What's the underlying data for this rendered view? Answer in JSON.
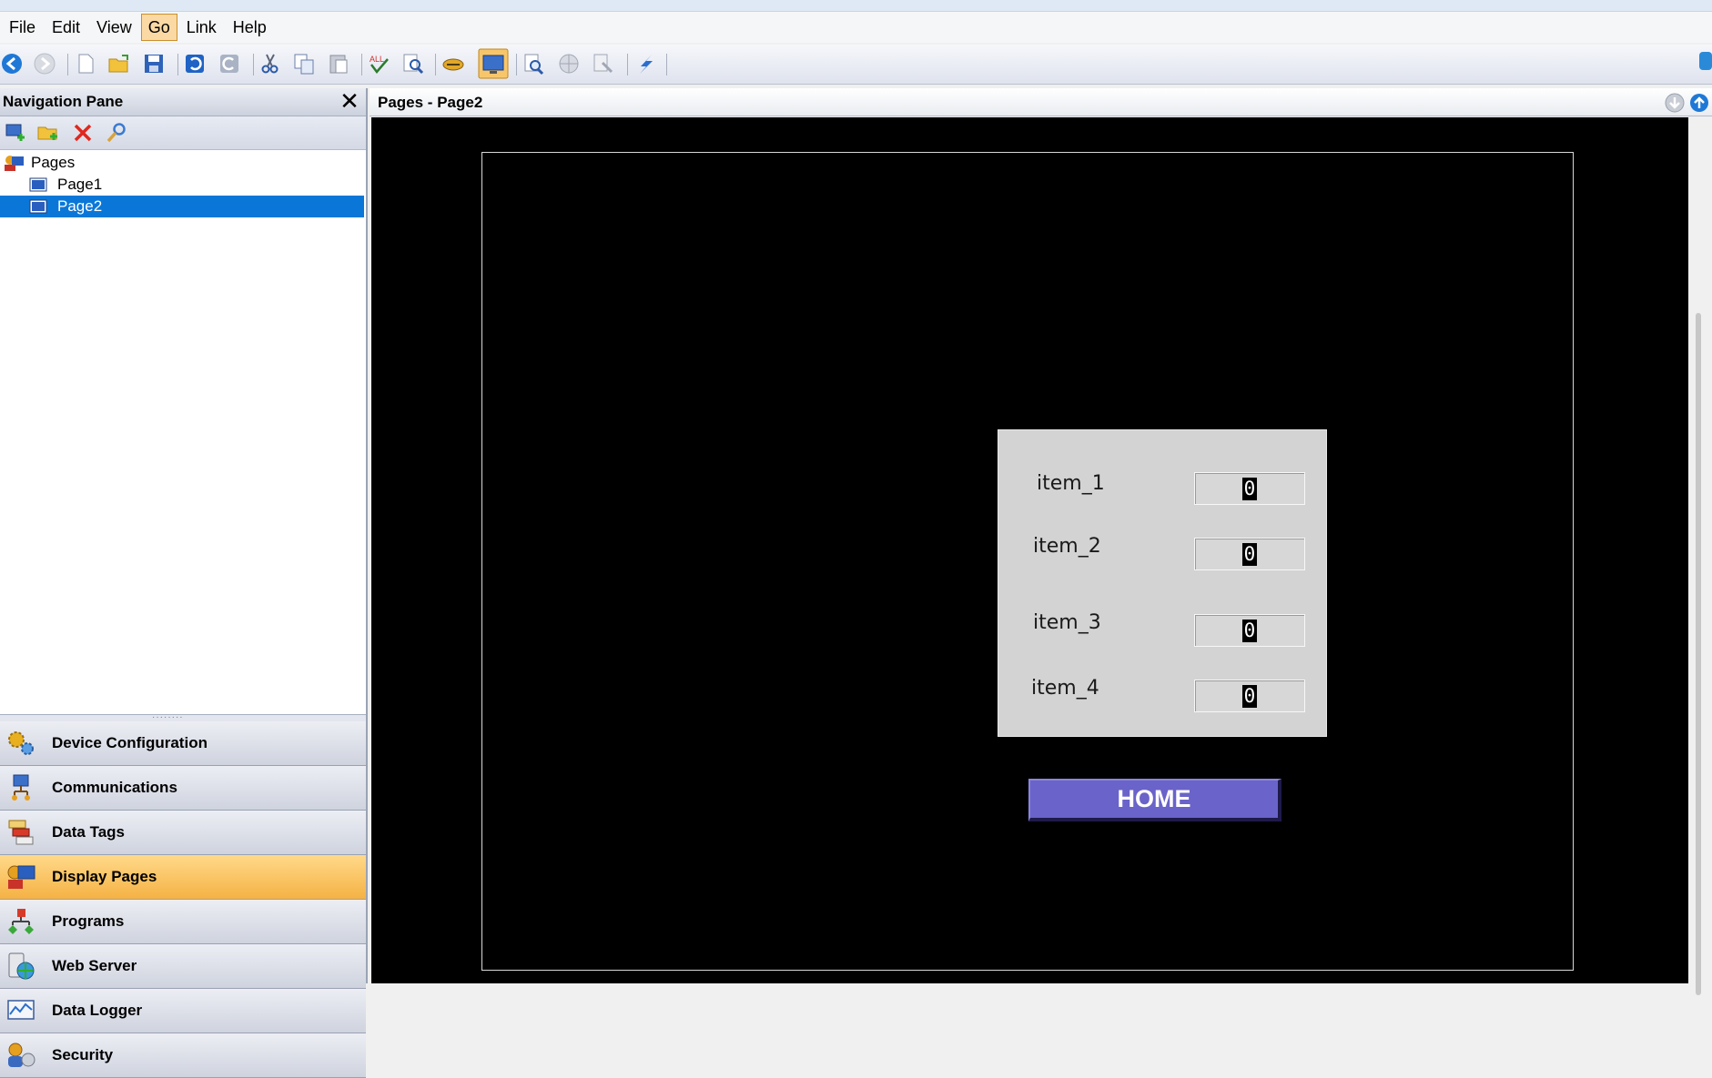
{
  "menu": {
    "items": [
      {
        "label": "File",
        "active": false
      },
      {
        "label": "Edit",
        "active": false
      },
      {
        "label": "View",
        "active": false
      },
      {
        "label": "Go",
        "active": true
      },
      {
        "label": "Link",
        "active": false
      },
      {
        "label": "Help",
        "active": false
      }
    ]
  },
  "toolbar": {
    "icons": [
      "back-icon",
      "forward-icon",
      "new-icon",
      "open-icon",
      "save-icon",
      "undo-icon",
      "redo-icon",
      "cut-icon",
      "copy-icon",
      "paste-icon",
      "spell-check-icon",
      "find-replace-icon",
      "handshake-icon",
      "display-icon",
      "zoom-icon",
      "globe-icon",
      "print-icon",
      "lightning-icon"
    ],
    "active_icon": "display-icon"
  },
  "nav": {
    "title": "Navigation Pane",
    "tree": {
      "root": "Pages",
      "children": [
        {
          "label": "Page1",
          "selected": false
        },
        {
          "label": "Page2",
          "selected": true
        }
      ]
    },
    "sections": [
      {
        "label": "Device Configuration",
        "icon": "gears-icon",
        "active": false
      },
      {
        "label": "Communications",
        "icon": "network-icon",
        "active": false
      },
      {
        "label": "Data Tags",
        "icon": "tags-icon",
        "active": false
      },
      {
        "label": "Display Pages",
        "icon": "display-pages-icon",
        "active": true
      },
      {
        "label": "Programs",
        "icon": "programs-icon",
        "active": false
      },
      {
        "label": "Web Server",
        "icon": "web-server-icon",
        "active": false
      },
      {
        "label": "Data Logger",
        "icon": "data-logger-icon",
        "active": false
      },
      {
        "label": "Security",
        "icon": "security-icon",
        "active": false
      }
    ]
  },
  "doc": {
    "title": "Pages - Page2"
  },
  "page": {
    "items": [
      {
        "label": "item_1",
        "value": "0"
      },
      {
        "label": "item_2",
        "value": "0"
      },
      {
        "label": "item_3",
        "value": "0"
      },
      {
        "label": "item_4",
        "value": "0"
      }
    ],
    "home_button": "HOME"
  },
  "colors": {
    "selection": "#0a77d8",
    "active_section": "#f5b244",
    "home_button": "#6a63c9",
    "canvas": "#000000",
    "panel": "#d3d3d3"
  }
}
